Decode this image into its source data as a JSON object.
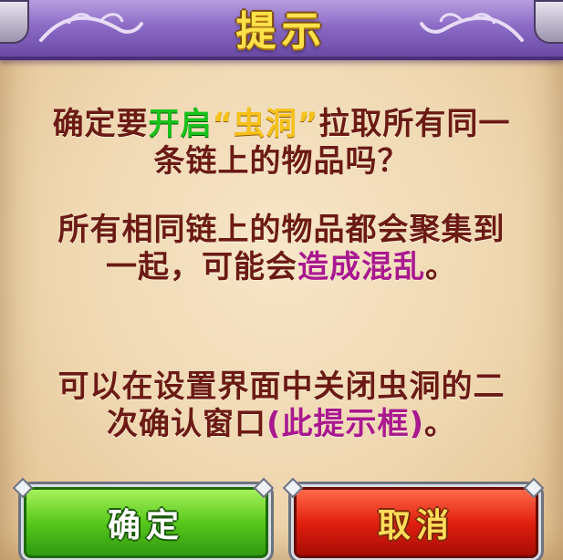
{
  "dialog": {
    "title": "提示",
    "line1": {
      "a": "确定要",
      "b": "开启",
      "c": "“虫洞”",
      "d": "拉取所有同一",
      "e": "条链上的物品吗？"
    },
    "line2": {
      "a": "所有相同链上的物品都会聚集到",
      "b": "一起，可能会",
      "c": "造成混乱",
      "d": "。"
    },
    "line3": {
      "a": "可以在设置界面中关闭虫洞的二",
      "b": "次确认窗口",
      "c": "(此提示框)",
      "d": "。"
    }
  },
  "buttons": {
    "confirm": "确定",
    "cancel": "取消"
  },
  "colors": {
    "header": "#8d6cc6",
    "title": "#ffe24a",
    "text": "#6b1a14",
    "highlight_green": "#17c21a",
    "highlight_yellow": "#f6c21a",
    "highlight_purple": "#a9188e",
    "confirm_button": "#58c81c",
    "cancel_button": "#e0200e"
  }
}
